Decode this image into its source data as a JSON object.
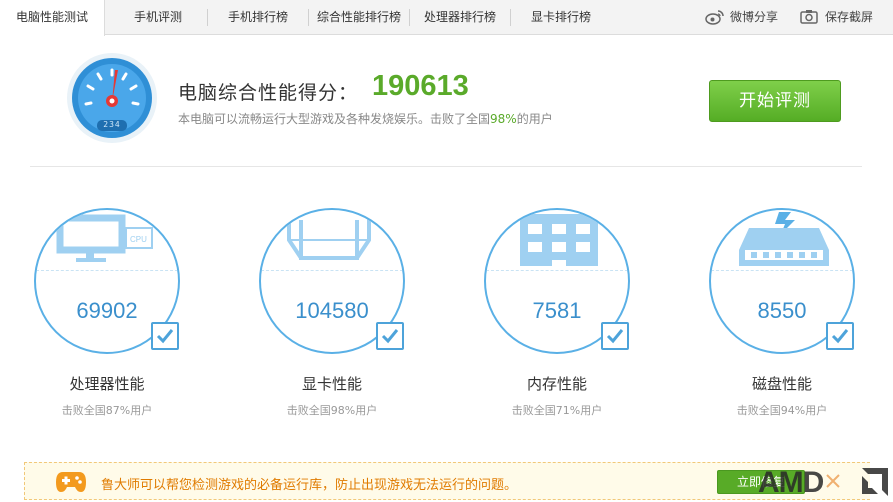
{
  "tabs": [
    {
      "label": "电脑性能测试",
      "active": true
    },
    {
      "label": "手机评测",
      "active": false
    },
    {
      "label": "手机排行榜",
      "active": false
    },
    {
      "label": "综合性能排行榜",
      "active": false
    },
    {
      "label": "处理器排行榜",
      "active": false
    },
    {
      "label": "显卡排行榜",
      "active": false
    }
  ],
  "tools": {
    "weibo_share": "微博分享",
    "save_screenshot": "保存截屏"
  },
  "summary": {
    "gauge_digits": "234",
    "score_label": "电脑综合性能得分：",
    "score": "190613",
    "desc_before": "本电脑可以流畅运行大型游戏及各种发烧娱乐。击败了全国",
    "desc_percent": "98%",
    "desc_after": "的用户",
    "start_button": "开始评测"
  },
  "components": [
    {
      "name": "处理器性能",
      "score": "69902",
      "beat": "击败全国87%用户",
      "icon": "monitor-cpu-icon"
    },
    {
      "name": "显卡性能",
      "score": "104580",
      "beat": "击败全国98%用户",
      "icon": "cube-icon"
    },
    {
      "name": "内存性能",
      "score": "7581",
      "beat": "击败全国71%用户",
      "icon": "memory-chip-icon"
    },
    {
      "name": "磁盘性能",
      "score": "8550",
      "beat": "击败全国94%用户",
      "icon": "hard-disk-icon"
    }
  ],
  "notice": {
    "message": "鲁大师可以帮您检测游戏的必备运行库，防止出现游戏无法运行的问题。",
    "fix_button": "立即修复"
  },
  "watermark": "AMD",
  "colors": {
    "accent_blue": "#5ab0e6",
    "score_green": "#5aaa2a",
    "button_green": "#58ab27",
    "notice_orange": "#e07b00"
  }
}
